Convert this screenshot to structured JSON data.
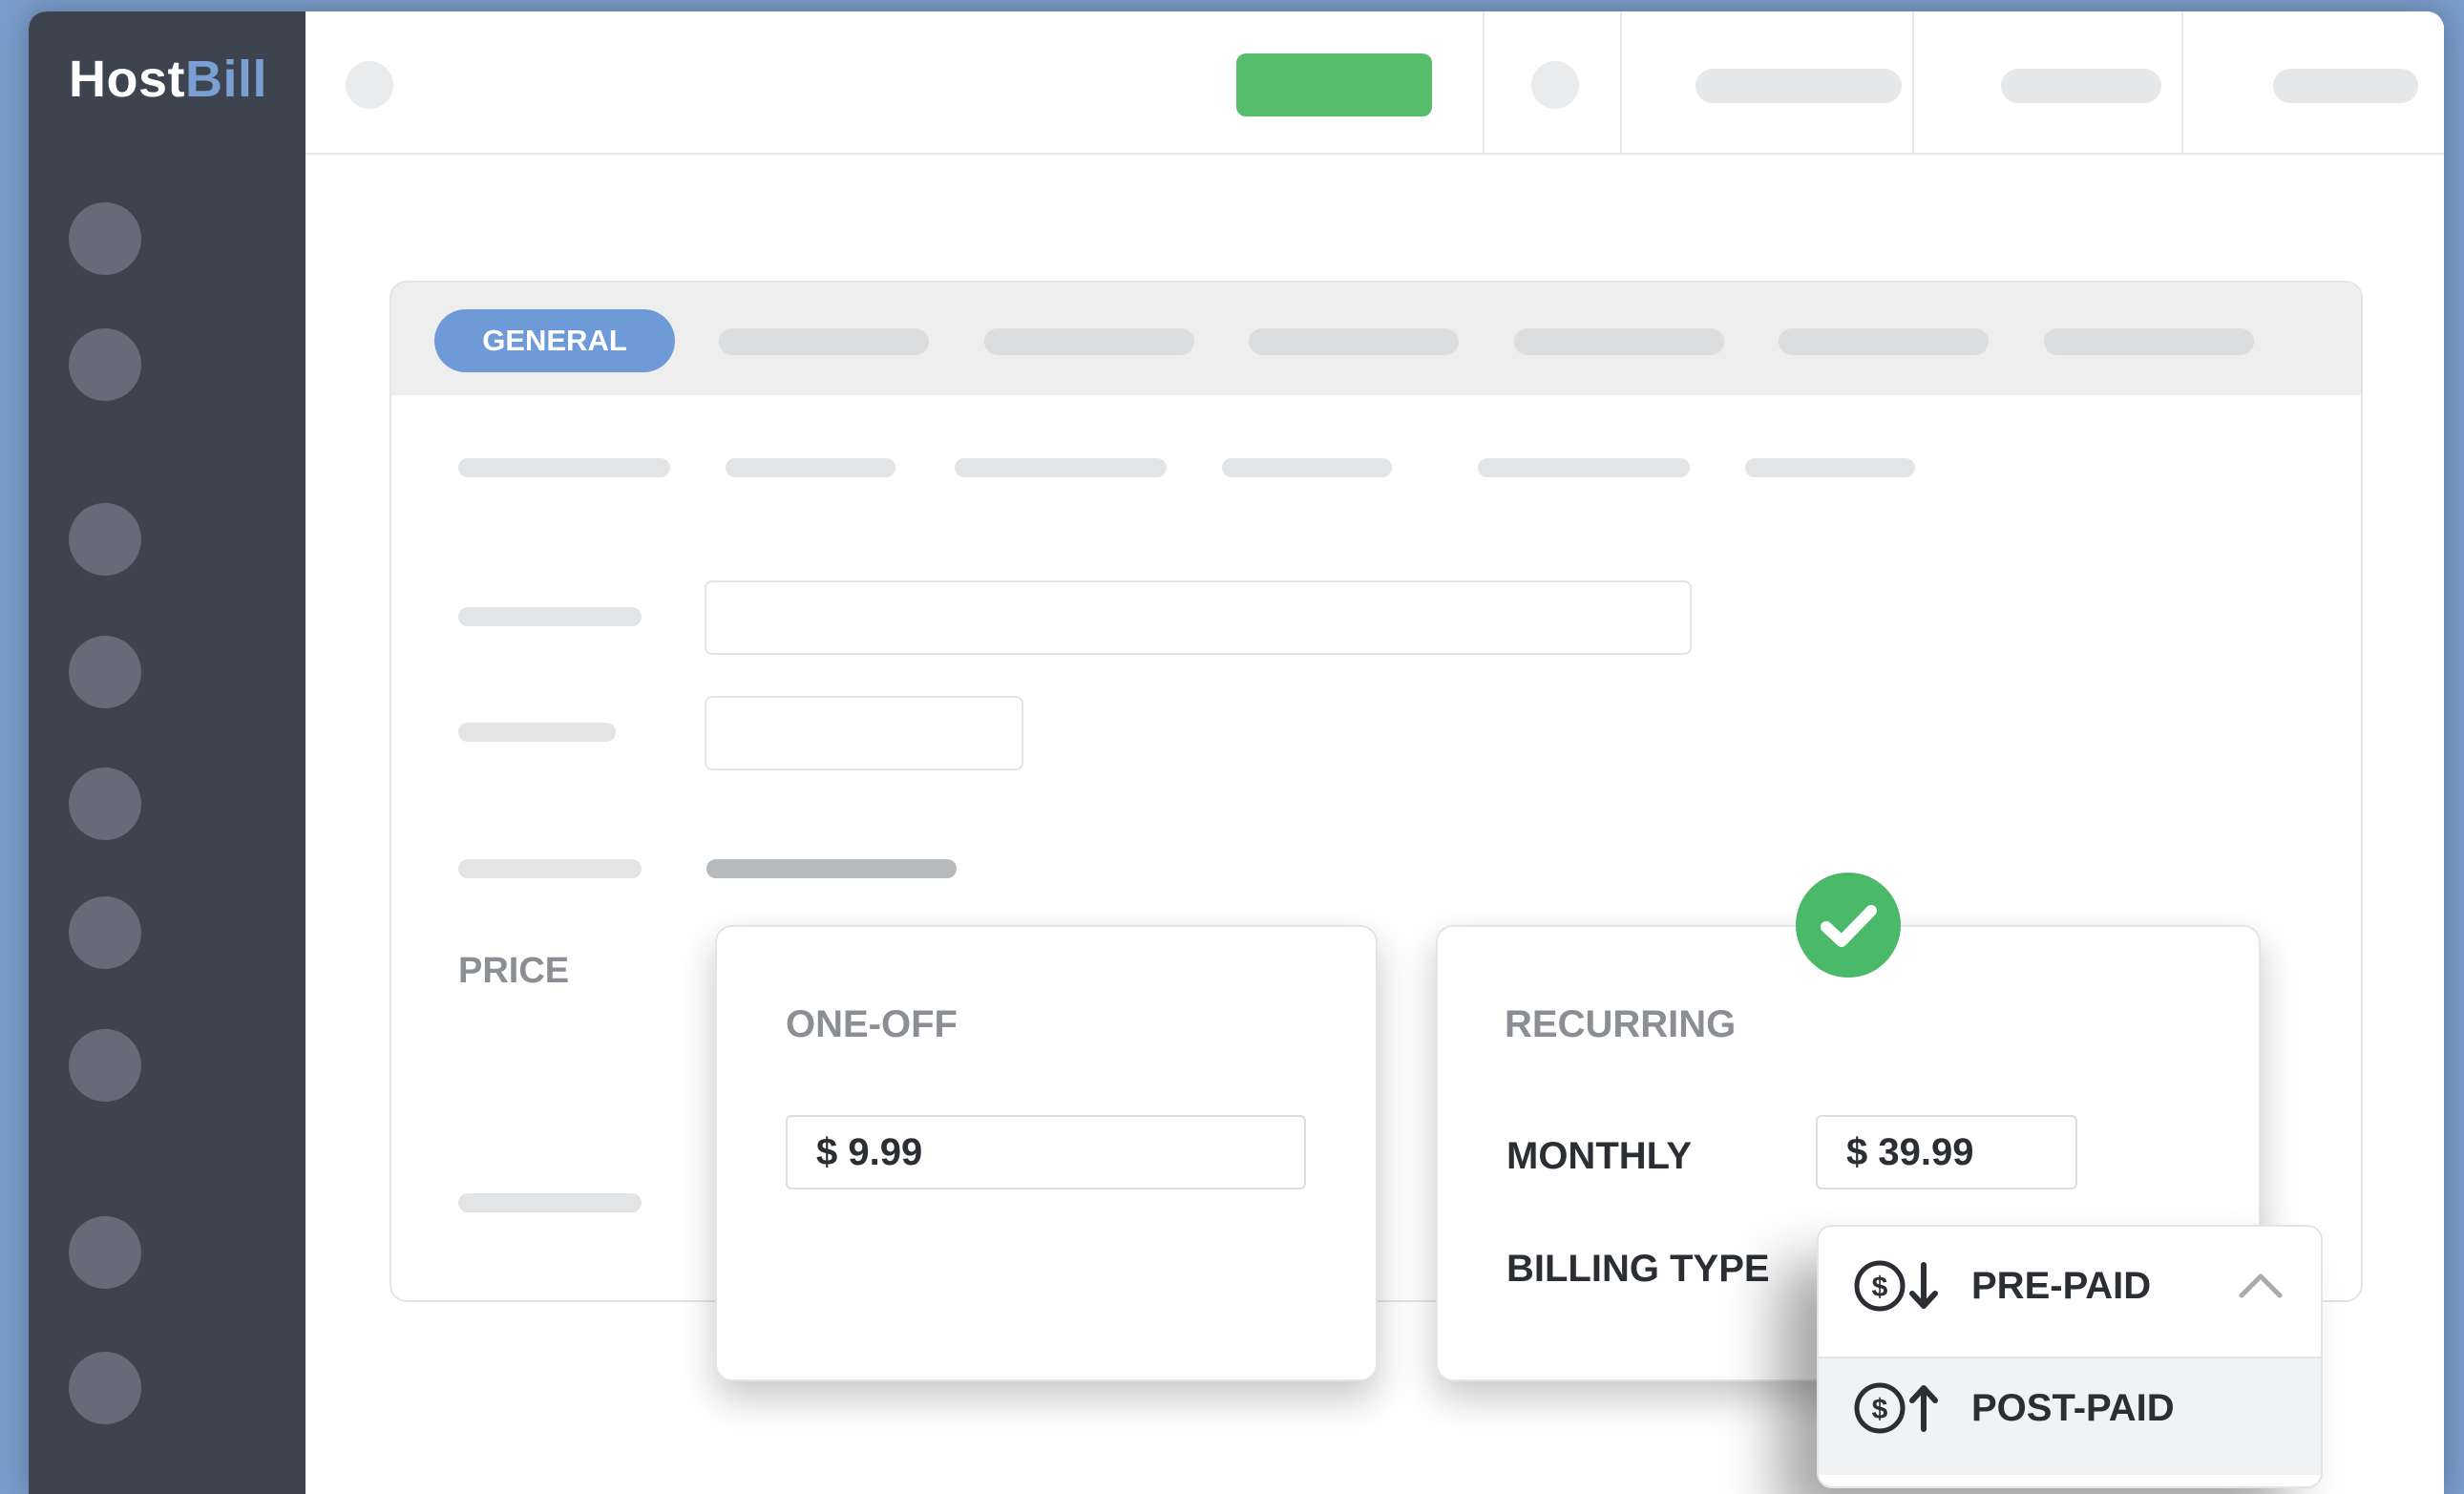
{
  "app": {
    "logo_host": "Host",
    "logo_bill": "Bill"
  },
  "tabs": {
    "active_label": "GENERAL"
  },
  "pricing": {
    "section_label": "PRICE",
    "one_off": {
      "title": "ONE-OFF",
      "value": "$ 9.99"
    },
    "recurring": {
      "title": "RECURRING",
      "monthly_label": "MONTHLY",
      "monthly_value": "$ 39.99",
      "billing_type_label": "BILLING TYPE",
      "selected": true
    }
  },
  "billing_dropdown": {
    "options": [
      {
        "label": "PRE-PAID",
        "icon": "dollar-arrow-down-icon"
      },
      {
        "label": "POST-PAID",
        "icon": "dollar-arrow-up-icon"
      }
    ]
  },
  "colors": {
    "sidebar": "#3d4450",
    "accent_blue": "#6f9ad8",
    "green": "#56be6b",
    "check_green": "#4bb96a",
    "text_dark": "#2b2e33",
    "text_muted": "#8b8e93"
  }
}
